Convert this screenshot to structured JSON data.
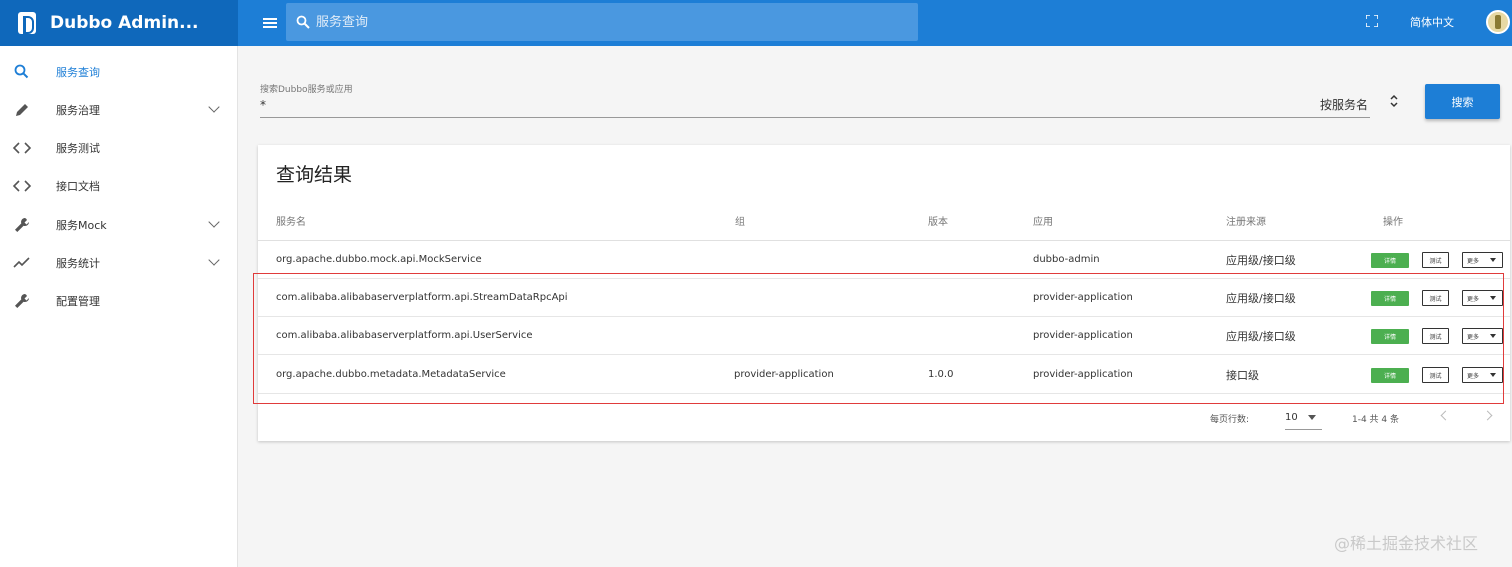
{
  "app": {
    "title": "Dubbo Admin...",
    "search_placeholder": "服务查询",
    "language": "简体中文"
  },
  "sidebar": {
    "items": [
      {
        "label": "服务查询",
        "icon": "search-icon",
        "active": true,
        "expandable": false
      },
      {
        "label": "服务治理",
        "icon": "pencil-icon",
        "active": false,
        "expandable": true
      },
      {
        "label": "服务测试",
        "icon": "code-icon",
        "active": false,
        "expandable": false
      },
      {
        "label": "接口文档",
        "icon": "code-icon",
        "active": false,
        "expandable": false
      },
      {
        "label": "服务Mock",
        "icon": "wrench-icon",
        "active": false,
        "expandable": true
      },
      {
        "label": "服务统计",
        "icon": "trending-icon",
        "active": false,
        "expandable": true
      },
      {
        "label": "配置管理",
        "icon": "wrench-icon",
        "active": false,
        "expandable": false
      }
    ]
  },
  "search": {
    "label": "搜索Dubbo服务或应用",
    "value": "*",
    "search_by": "按服务名",
    "button": "搜索"
  },
  "results": {
    "title": "查询结果",
    "columns": [
      "服务名",
      "组",
      "版本",
      "应用",
      "注册来源",
      "操作"
    ],
    "rows": [
      {
        "service": "org.apache.dubbo.mock.api.MockService",
        "group": "",
        "version": "",
        "app": "dubbo-admin",
        "source": "应用级/接口级"
      },
      {
        "service": "com.alibaba.alibabaserverplatform.api.StreamDataRpcApi",
        "group": "",
        "version": "",
        "app": "provider-application",
        "source": "应用级/接口级"
      },
      {
        "service": "com.alibaba.alibabaserverplatform.api.UserService",
        "group": "",
        "version": "",
        "app": "provider-application",
        "source": "应用级/接口级"
      },
      {
        "service": "org.apache.dubbo.metadata.MetadataService",
        "group": "provider-application",
        "version": "1.0.0",
        "app": "provider-application",
        "source": "接口级"
      }
    ],
    "actions": {
      "detail": "详情",
      "test": "测试",
      "more": "更多"
    }
  },
  "pagination": {
    "rows_per_page_label": "每页行数:",
    "rows_per_page": "10",
    "range": "1-4 共 4 条"
  },
  "watermark": "@稀土掘金技术社区",
  "colors": {
    "primary": "#1d7ed6",
    "brand_dark": "#0f68bb",
    "success": "#4caf50",
    "highlight": "#e03b3b"
  }
}
